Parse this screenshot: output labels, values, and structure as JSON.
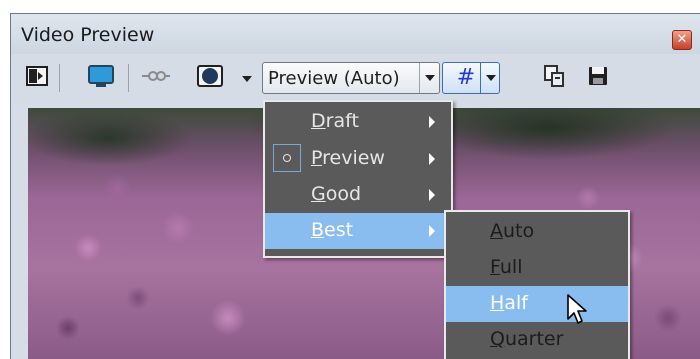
{
  "window": {
    "title": "Video Preview",
    "close_icon": "close-icon"
  },
  "toolbar": {
    "icons": [
      "split-screen-icon",
      "monitor-icon",
      "scope-icon",
      "overlay-icon",
      "dropdown-arrow-icon",
      "overlay-grid-icon",
      "copy-snapshot-icon",
      "save-snapshot-icon"
    ],
    "quality_combo": "Preview (Auto)",
    "grid_glyph": "#"
  },
  "quality_menu": {
    "items": [
      {
        "label": "Draft",
        "accel": "D",
        "rest": "raft",
        "has_submenu": true,
        "checked": false,
        "highlighted": false
      },
      {
        "label": "Preview",
        "accel": "P",
        "rest": "review",
        "has_submenu": true,
        "checked": true,
        "highlighted": false
      },
      {
        "label": "Good",
        "accel": "G",
        "rest": "ood",
        "has_submenu": true,
        "checked": false,
        "highlighted": false
      },
      {
        "label": "Best",
        "accel": "B",
        "rest": "est",
        "has_submenu": true,
        "checked": false,
        "highlighted": true
      }
    ]
  },
  "size_submenu": {
    "items": [
      {
        "label": "Auto",
        "accel": "A",
        "rest": "uto",
        "highlighted": false
      },
      {
        "label": "Full",
        "accel": "F",
        "rest": "ull",
        "highlighted": false
      },
      {
        "label": "Half",
        "accel": "H",
        "rest": "alf",
        "highlighted": true
      },
      {
        "label": "Quarter",
        "accel": "Q",
        "rest": "uarter",
        "highlighted": false
      }
    ]
  },
  "colors": {
    "menu_bg": "#5a5a5a",
    "highlight": "#89bdf0",
    "titlebar": "#d6dde6",
    "grid_glyph": "#2a35d6"
  }
}
